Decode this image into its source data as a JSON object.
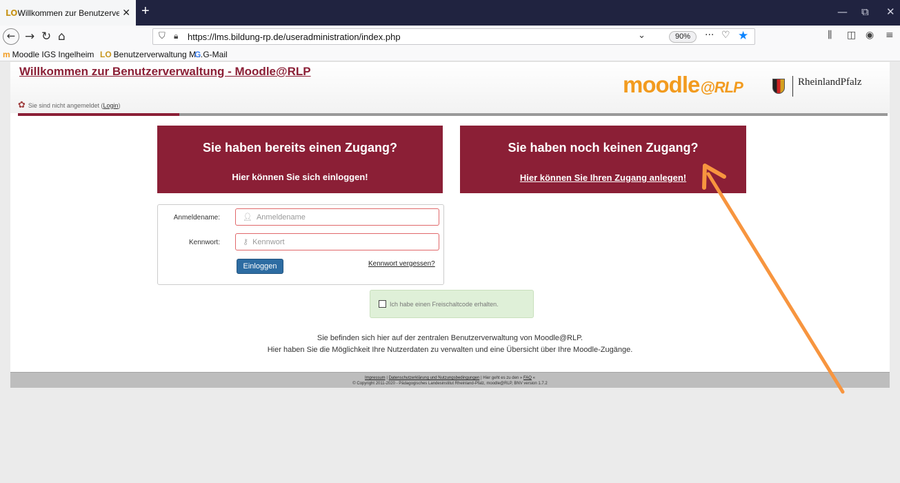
{
  "browser": {
    "tab_title": "Willkommen zur Benutzerverwaltung",
    "tab_favicon": "LO",
    "new_tab": "+",
    "window_controls": {
      "minimize": "—",
      "restore": "⧉",
      "close": "✕"
    },
    "url": "https://lms.bildung-rp.de/useradministration/index.php",
    "zoom": "90%",
    "page_actions": "···",
    "bookmarks": [
      {
        "icon": "m",
        "label": "Moodle IGS Ingelheim"
      },
      {
        "icon": "LO",
        "label": "Benutzerverwaltung M..."
      },
      {
        "icon": "G",
        "label": "G-Mail"
      }
    ]
  },
  "header": {
    "title": "Willkommen zur Benutzerverwaltung - Moodle@RLP",
    "status_prefix": "Sie sind nicht angemeldet (",
    "status_link": "Login",
    "status_suffix": ")",
    "logo_main": "moodle",
    "logo_suffix": "@RLP",
    "brand": "RheinlandPfalz"
  },
  "panels": {
    "login": {
      "title": "Sie haben bereits einen Zugang?",
      "subtitle": "Hier können Sie sich einloggen!"
    },
    "register": {
      "title": "Sie haben noch keinen Zugang?",
      "link": "Hier können Sie Ihren Zugang anlegen!"
    }
  },
  "login_form": {
    "username_label": "Anmeldename:",
    "username_placeholder": "Anmeldename",
    "password_label": "Kennwort:",
    "password_placeholder": "Kennwort",
    "submit_label": "Einloggen",
    "forgot_label": "Kennwort vergessen?"
  },
  "activation": {
    "label": "Ich habe einen Freischaltcode erhalten."
  },
  "info": {
    "line1": "Sie befinden sich hier auf der zentralen Benutzerverwaltung von Moodle@RLP.",
    "line2": "Hier haben Sie die Möglichkeit Ihre Nutzerdaten zu verwalten und eine Übersicht über Ihre Moodle-Zugänge."
  },
  "footer": {
    "impressum": "Impressum",
    "sep": " | ",
    "privacy": "Datenschutzerklärung und Nutzungsbedingungen",
    "faq_prefix": " | Hier geht es zu den » ",
    "faq": "FAQ",
    "faq_suffix": " «",
    "copyright": "© Copyright 2011-2020 - Pädagogisches Landesinstitut Rheinland-Pfalz, moodle@RLP, BNV version 1.7.2"
  },
  "colors": {
    "brand": "#8b1f36",
    "button": "#2d6ca2",
    "arrow": "#f7953f",
    "logo": "#f29b1f"
  }
}
